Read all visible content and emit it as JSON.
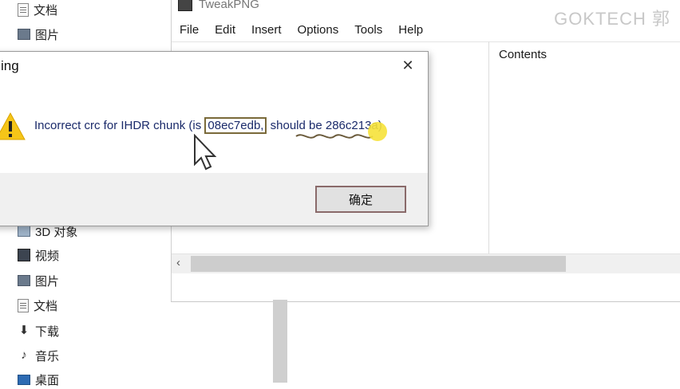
{
  "explorer": {
    "items": [
      {
        "label": "文档",
        "icon": "document-icon"
      },
      {
        "label": "图片",
        "icon": "pictures-icon"
      },
      {
        "label": "3D 对象",
        "icon": "3d-objects-icon"
      },
      {
        "label": "视频",
        "icon": "videos-icon"
      },
      {
        "label": "图片",
        "icon": "pictures-icon"
      },
      {
        "label": "文档",
        "icon": "document-icon"
      },
      {
        "label": "下载",
        "icon": "download-icon"
      },
      {
        "label": "音乐",
        "icon": "music-icon"
      },
      {
        "label": "桌面",
        "icon": "desktop-icon"
      }
    ]
  },
  "tweak": {
    "title": "TweakPNG",
    "menu": [
      "File",
      "Edit",
      "Insert",
      "Options",
      "Tools",
      "Help"
    ],
    "contents_header": "Contents"
  },
  "watermark": "GOKTECH 郭",
  "dialog": {
    "title": "ing",
    "close_symbol": "✕",
    "message_pre": "Incorrect crc for IHDR chunk (is ",
    "crc_actual": "08ec7edb,",
    "message_mid": " should be 286c213a)",
    "ok_label": "确定"
  }
}
